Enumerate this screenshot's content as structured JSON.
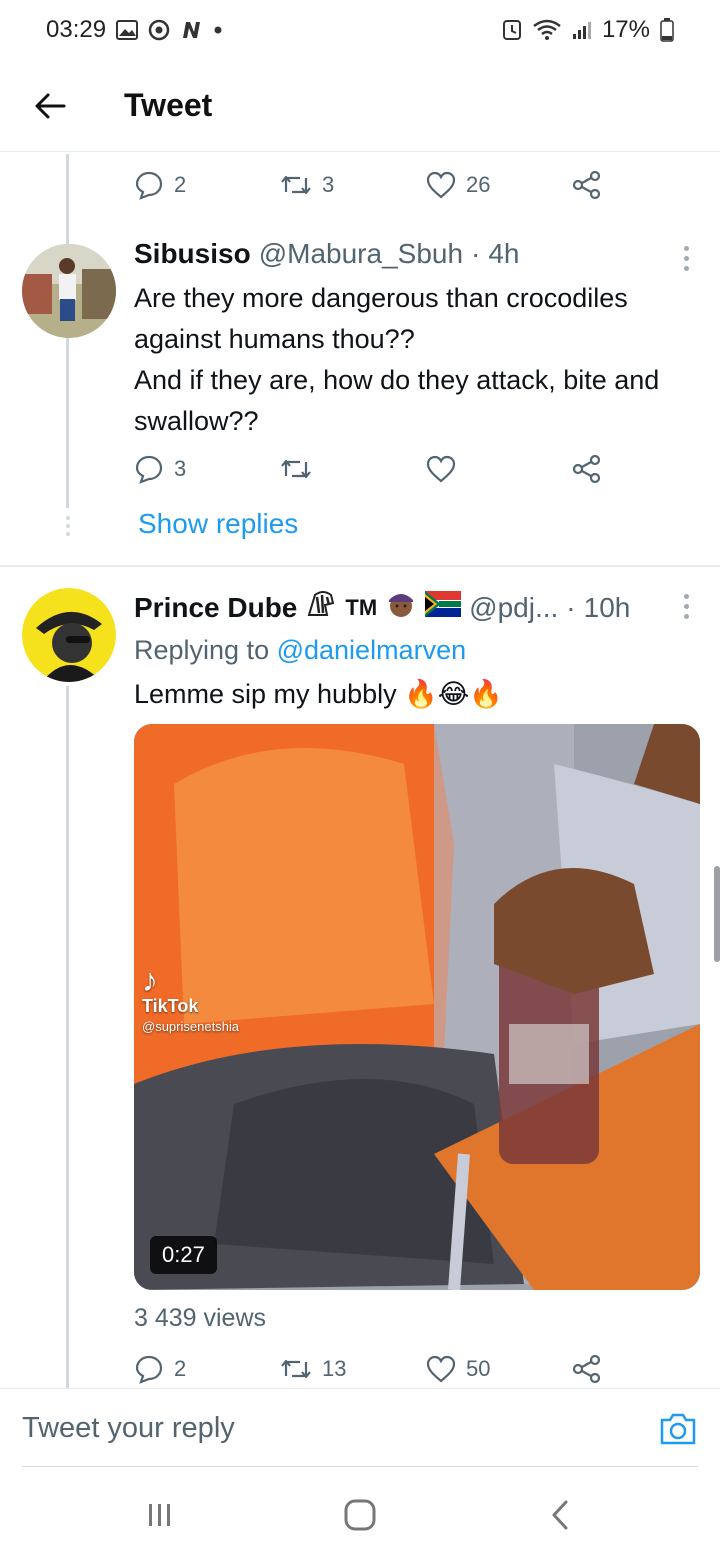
{
  "status_bar": {
    "time": "03:29",
    "notification_icons": [
      "gallery-icon",
      "chrome-icon",
      "n-app-icon",
      "dot-icon"
    ],
    "battery": "17%"
  },
  "header": {
    "title": "Tweet"
  },
  "first_tweet_actions": {
    "replies": "2",
    "retweets": "3",
    "likes": "26"
  },
  "reply1": {
    "name": "Sibusiso",
    "handle": "@Mabura_Sbuh",
    "separator": "·",
    "time": "4h",
    "text_line1": "Are they more dangerous than crocodiles against humans thou??",
    "text_line2": "And if they are, how do they attack, bite and swallow??",
    "replies": "3",
    "retweets": "",
    "likes": "",
    "show_replies": "Show replies"
  },
  "reply2": {
    "name": "Prince Dube",
    "name_suffix": "TM",
    "handle": "@pdj...",
    "separator": "·",
    "time": "10h",
    "replying_prefix": "Replying to ",
    "replying_to": "@danielmarven",
    "text": "Lemme sip my hubbly",
    "emoji": "🔥😂🔥",
    "media": {
      "watermark": "TikTok",
      "watermark_handle": "@suprisenetshia",
      "duration": "0:27"
    },
    "views": "3 439 views",
    "replies": "2",
    "retweets": "13",
    "likes": "50"
  },
  "reply_box": {
    "placeholder": "Tweet your reply"
  },
  "colors": {
    "accent": "#1d9bf0",
    "muted": "#536471",
    "divider": "#e6ecf0"
  }
}
